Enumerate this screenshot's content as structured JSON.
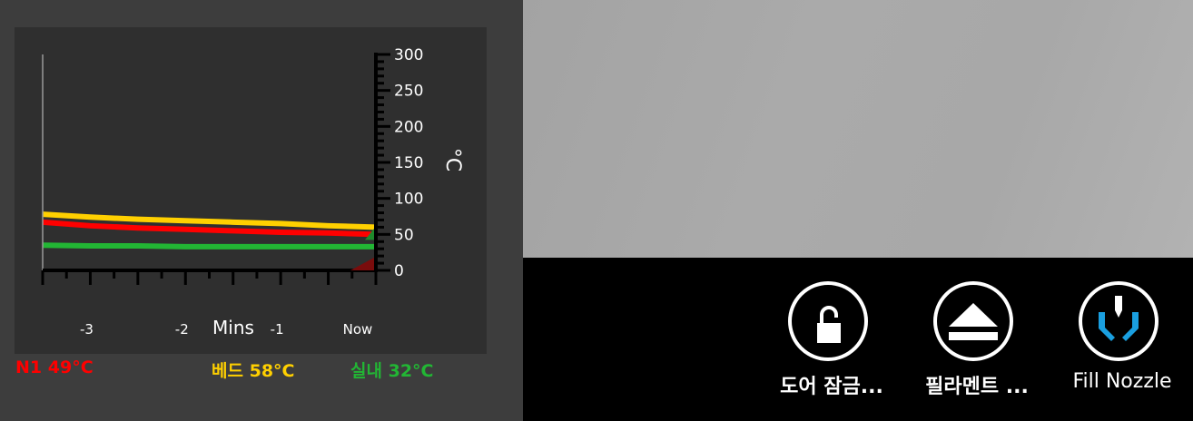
{
  "chart_data": {
    "type": "line",
    "xlabel": "Mins",
    "ylabel": "°C",
    "x_tick_labels": [
      {
        "value": -3,
        "label": "-3"
      },
      {
        "value": -2,
        "label": "-2"
      },
      {
        "value": -1,
        "label": "-1"
      },
      {
        "value": 0,
        "label": "Now"
      }
    ],
    "y_ticks": [
      0,
      50,
      100,
      150,
      200,
      250,
      300
    ],
    "xlim": [
      -3.5,
      0
    ],
    "ylim": [
      0,
      300
    ],
    "grid": false,
    "series": [
      {
        "name": "N1",
        "color": "#ff0000",
        "x": [
          -3.5,
          -3.0,
          -2.5,
          -2.0,
          -1.5,
          -1.0,
          -0.5,
          0
        ],
        "y": [
          67,
          62,
          59,
          57,
          55,
          53,
          52,
          50
        ]
      },
      {
        "name": "베드",
        "color": "#ffd000",
        "x": [
          -3.5,
          -3.0,
          -2.5,
          -2.0,
          -1.5,
          -1.0,
          -0.5,
          0
        ],
        "y": [
          78,
          74,
          71,
          69,
          67,
          65,
          62,
          60
        ]
      },
      {
        "name": "실내",
        "color": "#22b634",
        "x": [
          -3.5,
          -3.0,
          -2.5,
          -2.0,
          -1.5,
          -1.0,
          -0.5,
          0
        ],
        "y": [
          35,
          34,
          34,
          33,
          33,
          33,
          33,
          33
        ]
      }
    ]
  },
  "legend": [
    {
      "label": "N1",
      "value": "49°C",
      "color": "#ff0000"
    },
    {
      "label": "베드",
      "value": "58°C",
      "color": "#ffd000"
    },
    {
      "label": "실내",
      "value": "32°C",
      "color": "#22b634"
    }
  ],
  "toolbar": {
    "buttons": [
      {
        "label": "도어 잠금...",
        "icon": "unlock-icon"
      },
      {
        "label": "필라멘트 ...",
        "icon": "eject-icon"
      },
      {
        "label": "Fill Nozzle",
        "icon": "nozzle-icon"
      }
    ],
    "accent": "#1a9fe0"
  }
}
